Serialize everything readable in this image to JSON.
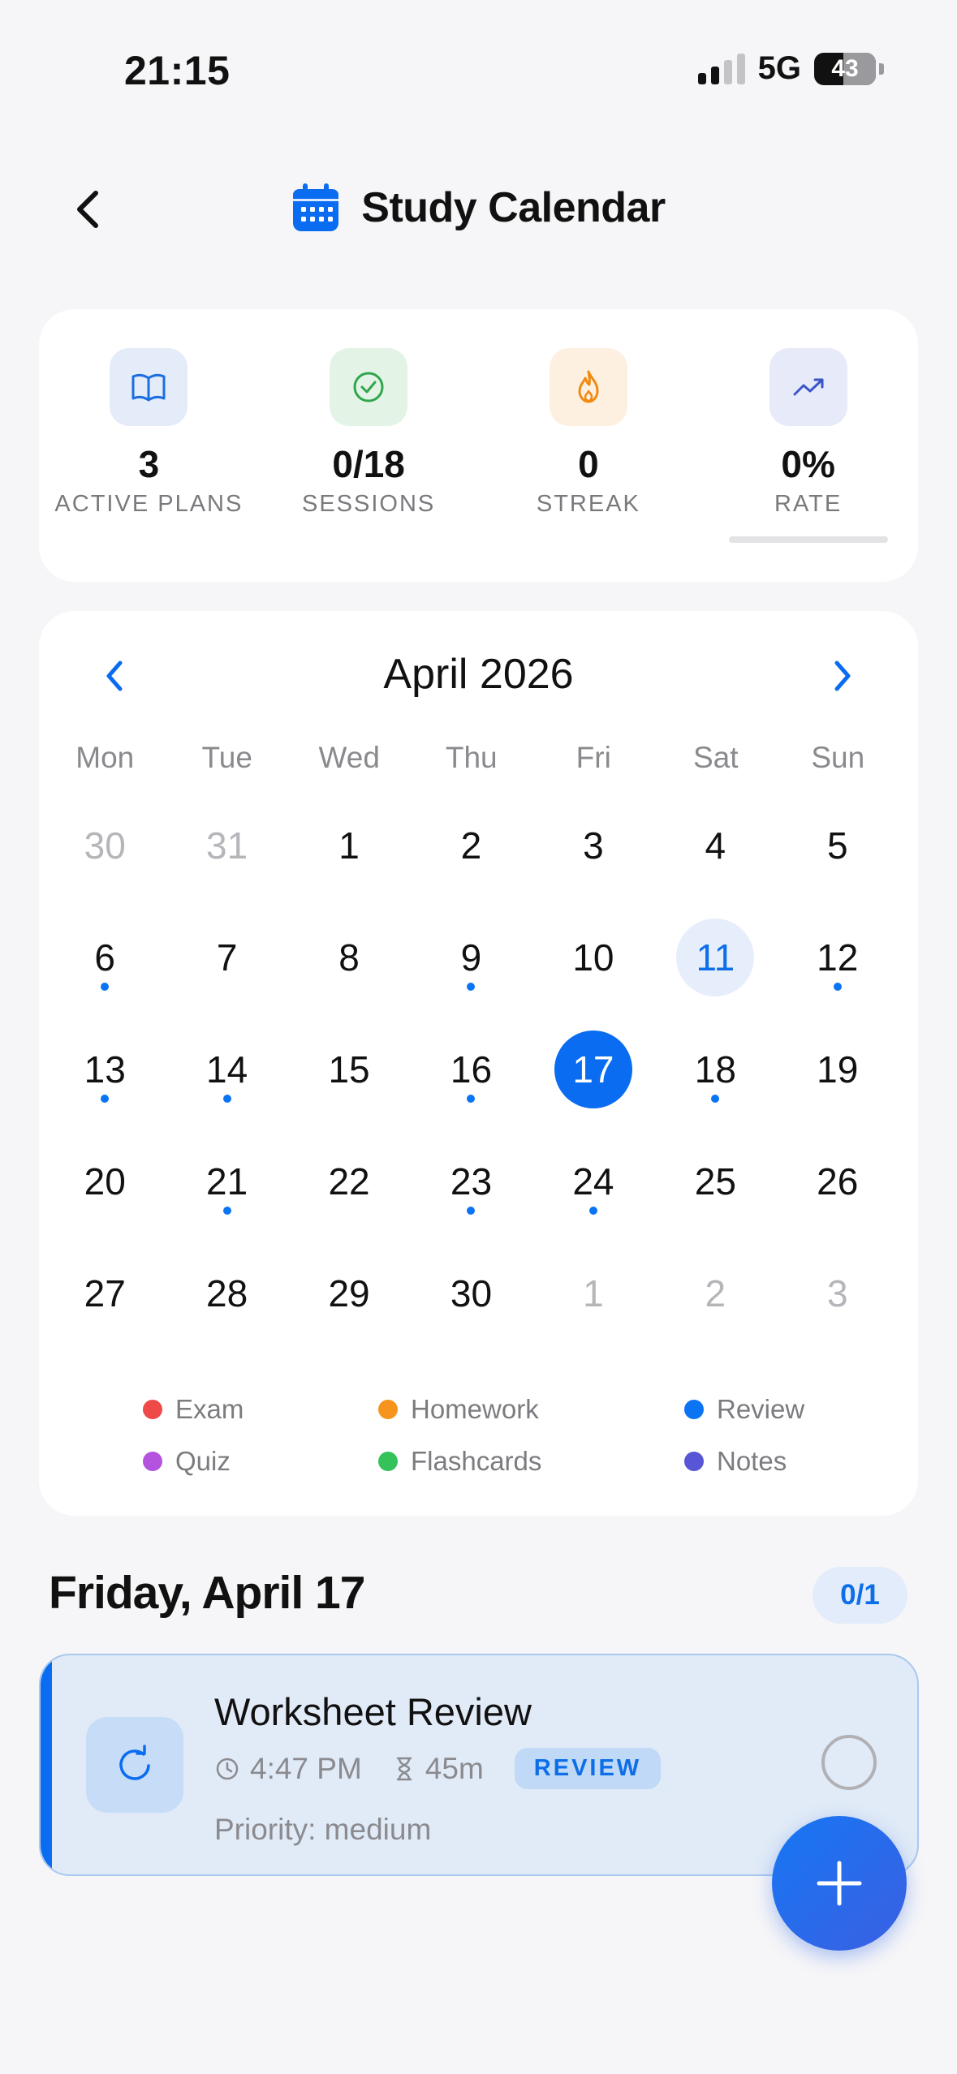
{
  "status_bar": {
    "time": "21:15",
    "network": "5G",
    "battery": "43"
  },
  "header": {
    "title": "Study Calendar",
    "back_icon": "chevron-left-icon",
    "title_icon": "calendar-icon"
  },
  "stats": [
    {
      "value": "3",
      "label": "ACTIVE PLANS",
      "icon": "book-icon",
      "color": "#1d6fe0",
      "bg": "#e4ecfa"
    },
    {
      "value": "0/18",
      "label": "SESSIONS",
      "icon": "check-circle-icon",
      "color": "#2fa64b",
      "bg": "#e3f4e6"
    },
    {
      "value": "0",
      "label": "STREAK",
      "icon": "flame-icon",
      "color": "#f08a12",
      "bg": "#fdf0e0"
    },
    {
      "value": "0%",
      "label": "RATE",
      "icon": "trending-up-icon",
      "color": "#3b55c9",
      "bg": "#e7eaf8",
      "progress": 0
    }
  ],
  "calendar": {
    "month_label": "April 2026",
    "weekdays": [
      "Mon",
      "Tue",
      "Wed",
      "Thu",
      "Fri",
      "Sat",
      "Sun"
    ],
    "weeks": [
      [
        {
          "d": "30",
          "out": true
        },
        {
          "d": "31",
          "out": true
        },
        {
          "d": "1"
        },
        {
          "d": "2"
        },
        {
          "d": "3"
        },
        {
          "d": "4"
        },
        {
          "d": "5"
        }
      ],
      [
        {
          "d": "6",
          "dot": true
        },
        {
          "d": "7"
        },
        {
          "d": "8"
        },
        {
          "d": "9",
          "dot": true
        },
        {
          "d": "10"
        },
        {
          "d": "11",
          "today": true
        },
        {
          "d": "12",
          "dot": true
        }
      ],
      [
        {
          "d": "13",
          "dot": true
        },
        {
          "d": "14",
          "dot": true
        },
        {
          "d": "15"
        },
        {
          "d": "16",
          "dot": true
        },
        {
          "d": "17",
          "selected": true
        },
        {
          "d": "18",
          "dot": true
        },
        {
          "d": "19"
        }
      ],
      [
        {
          "d": "20"
        },
        {
          "d": "21",
          "dot": true
        },
        {
          "d": "22"
        },
        {
          "d": "23",
          "dot": true
        },
        {
          "d": "24",
          "dot": true
        },
        {
          "d": "25"
        },
        {
          "d": "26"
        }
      ],
      [
        {
          "d": "27"
        },
        {
          "d": "28"
        },
        {
          "d": "29"
        },
        {
          "d": "30"
        },
        {
          "d": "1",
          "out": true
        },
        {
          "d": "2",
          "out": true
        },
        {
          "d": "3",
          "out": true
        }
      ]
    ],
    "legend": [
      {
        "label": "Exam",
        "color": "#f04a48"
      },
      {
        "label": "Homework",
        "color": "#f7941d"
      },
      {
        "label": "Review",
        "color": "#0a74f2"
      },
      {
        "label": "Quiz",
        "color": "#b453dd"
      },
      {
        "label": "Flashcards",
        "color": "#34c25a"
      },
      {
        "label": "Notes",
        "color": "#5856d6"
      }
    ]
  },
  "selected_day": {
    "title": "Friday, April 17",
    "count": "0/1",
    "session": {
      "title": "Worksheet Review",
      "time": "4:47 PM",
      "duration": "45m",
      "type": "REVIEW",
      "priority": "Priority: medium",
      "icon": "refresh-icon"
    }
  },
  "fab": {
    "icon": "plus-icon"
  }
}
